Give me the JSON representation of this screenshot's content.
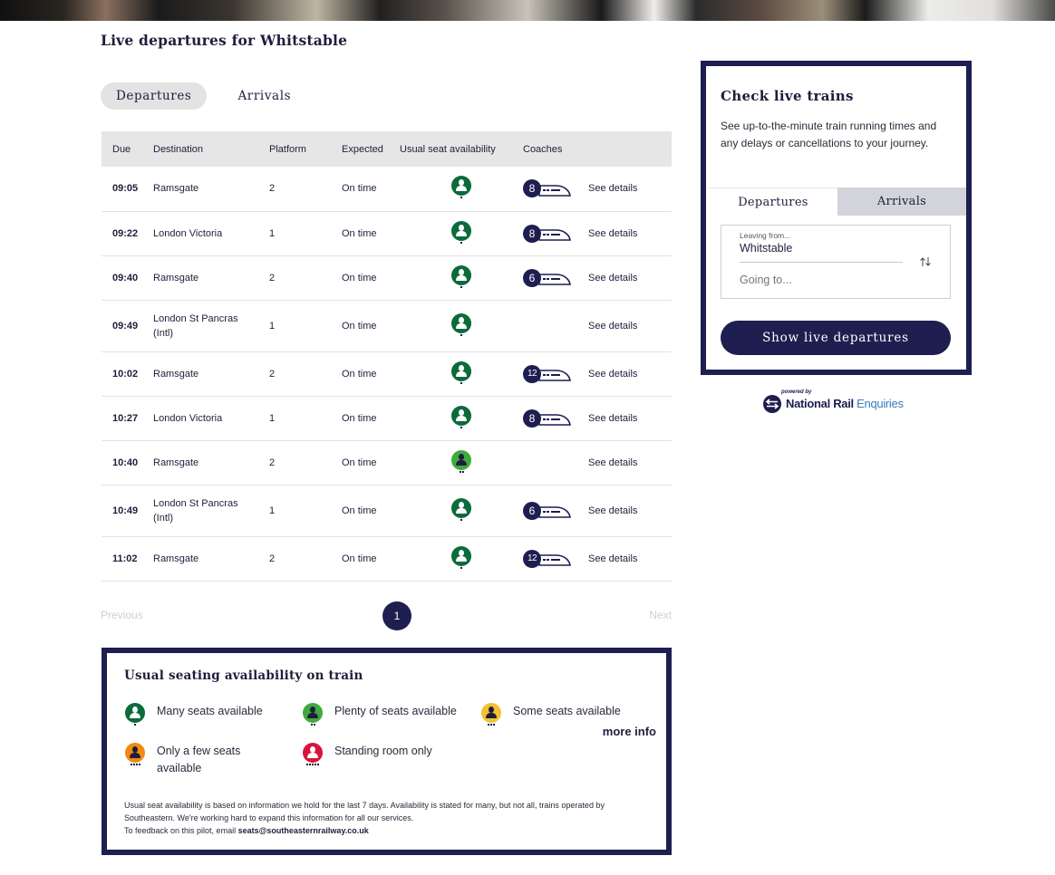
{
  "page": {
    "title": "Live departures for Whitstable",
    "tabs": [
      {
        "label": "Departures",
        "active": true
      },
      {
        "label": "Arrivals",
        "active": false
      }
    ]
  },
  "table": {
    "headers": [
      "Due",
      "Destination",
      "Platform",
      "Expected",
      "Usual seat availability",
      "Coaches",
      ""
    ],
    "rows": [
      {
        "due": "09:05",
        "destination": "Ramsgate",
        "platform": "2",
        "expected": "On time",
        "seat_level": "many",
        "coaches": "8",
        "details": "See details"
      },
      {
        "due": "09:22",
        "destination": "London Victoria",
        "platform": "1",
        "expected": "On time",
        "seat_level": "many",
        "coaches": "8",
        "details": "See details"
      },
      {
        "due": "09:40",
        "destination": "Ramsgate",
        "platform": "2",
        "expected": "On time",
        "seat_level": "many",
        "coaches": "6",
        "details": "See details"
      },
      {
        "due": "09:49",
        "destination": "London St Pancras",
        "destination_line2": "(Intl)",
        "platform": "1",
        "expected": "On time",
        "seat_level": "many",
        "coaches": "",
        "details": "See details"
      },
      {
        "due": "10:02",
        "destination": "Ramsgate",
        "platform": "2",
        "expected": "On time",
        "seat_level": "many",
        "coaches": "12",
        "details": "See details"
      },
      {
        "due": "10:27",
        "destination": "London Victoria",
        "platform": "1",
        "expected": "On time",
        "seat_level": "many",
        "coaches": "8",
        "details": "See details"
      },
      {
        "due": "10:40",
        "destination": "Ramsgate",
        "platform": "2",
        "expected": "On time",
        "seat_level": "plenty",
        "coaches": "",
        "details": "See details"
      },
      {
        "due": "10:49",
        "destination": "London St Pancras",
        "destination_line2": "(Intl)",
        "platform": "1",
        "expected": "On time",
        "seat_level": "many",
        "coaches": "6",
        "details": "See details"
      },
      {
        "due": "11:02",
        "destination": "Ramsgate",
        "platform": "2",
        "expected": "On time",
        "seat_level": "many",
        "coaches": "12",
        "details": "See details"
      }
    ]
  },
  "pager": {
    "previous": "Previous",
    "current_page": "1",
    "next": "Next"
  },
  "legend": {
    "title": "Usual seating availability on train",
    "items": [
      {
        "key": "many",
        "label": "Many seats available",
        "color": "#0b6b3a",
        "person": "#ffffff",
        "dots": 1
      },
      {
        "key": "plenty",
        "label": "Plenty of seats available",
        "color": "#3faa3f",
        "person": "#1e1e3c",
        "dots": 2
      },
      {
        "key": "some",
        "label": "Some seats available",
        "color": "#f2c12e",
        "person": "#1e1e3c",
        "dots": 3
      },
      {
        "key": "few",
        "label": "Only a few seats available",
        "color": "#f08a12",
        "person": "#1e1e3c",
        "dots": 4
      },
      {
        "key": "standing",
        "label": "Standing room only",
        "color": "#d9143a",
        "person": "#ffffff",
        "dots": 5
      }
    ],
    "more_info": "more info",
    "note_line1": "Usual seat availability is based on information we hold for the last 7 days. Availability is stated for many, but not all, trains operated by Southeastern. We're working hard to expand this information for all our services.",
    "note_line2_prefix": "To feedback on this pilot, email ",
    "note_email": "seats@southeasternrailway.co.uk"
  },
  "widget": {
    "title": "Check live trains",
    "description": "See up-to-the-minute train running times and any delays or cancellations to your journey.",
    "tabs": [
      {
        "label": "Departures",
        "active": true
      },
      {
        "label": "Arrivals",
        "active": false
      }
    ],
    "leaving_label": "Leaving from...",
    "leaving_value": "Whitstable",
    "going_placeholder": "Going to...",
    "swap_icon": "swap-arrows-icon",
    "button": "Show live departures"
  },
  "nre": {
    "powered_by": "powered by",
    "name_bold": "National Rail",
    "name_light": "Enquiries"
  },
  "colors": {
    "brand_navy": "#1e1e50"
  }
}
